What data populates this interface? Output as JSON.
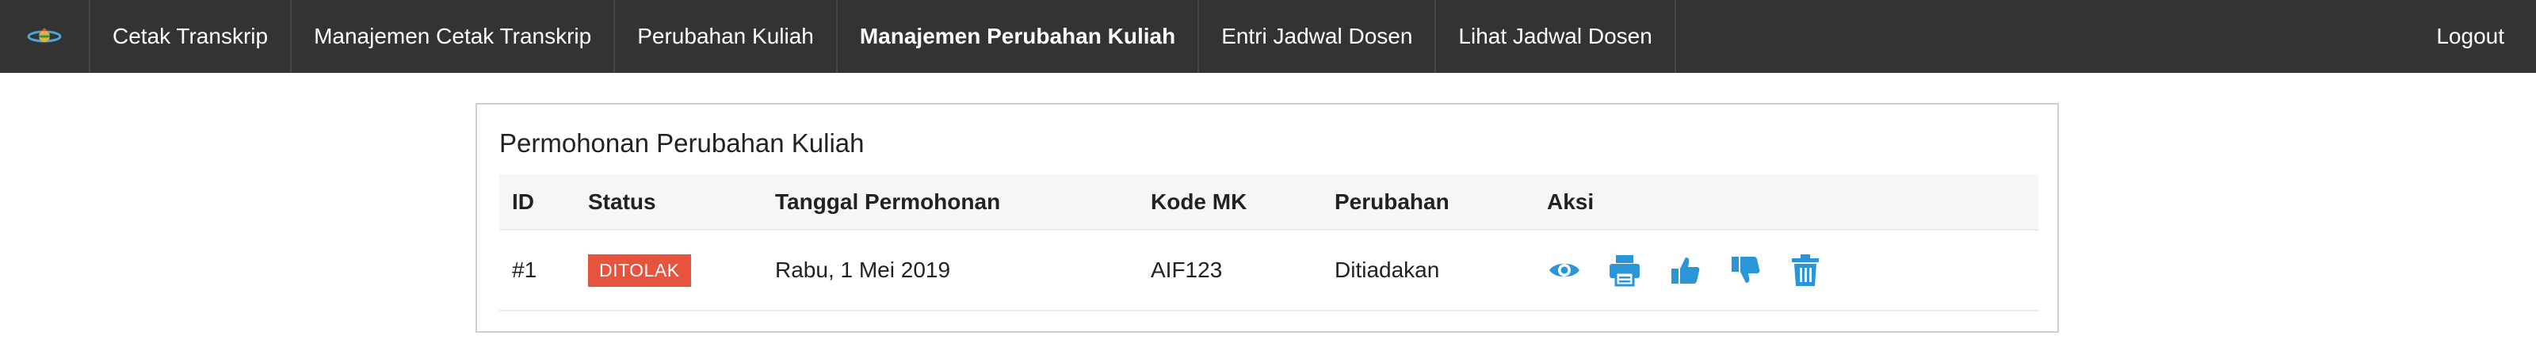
{
  "nav": {
    "logo_icon": "university-logo-icon",
    "items": [
      {
        "label": "Cetak Transkrip",
        "active": false
      },
      {
        "label": "Manajemen Cetak Transkrip",
        "active": false
      },
      {
        "label": "Perubahan Kuliah",
        "active": false
      },
      {
        "label": "Manajemen Perubahan Kuliah",
        "active": true
      },
      {
        "label": "Entri Jadwal Dosen",
        "active": false
      },
      {
        "label": "Lihat Jadwal Dosen",
        "active": false
      }
    ],
    "logout": "Logout"
  },
  "panel": {
    "title": "Permohonan Perubahan Kuliah",
    "columns": [
      "ID",
      "Status",
      "Tanggal Permohonan",
      "Kode MK",
      "Perubahan",
      "Aksi"
    ],
    "rows": [
      {
        "id": "#1",
        "status": "DITOLAK",
        "status_color": "#e8533d",
        "tanggal": "Rabu, 1 Mei 2019",
        "kode_mk": "AIF123",
        "perubahan": "Ditiadakan",
        "actions": [
          "eye-icon",
          "printer-icon",
          "thumbs-up-icon",
          "thumbs-down-icon",
          "trash-icon"
        ]
      }
    ]
  },
  "colors": {
    "navbar": "#333333",
    "action_icon": "#2b95d9",
    "badge_rejected": "#e8533d"
  }
}
